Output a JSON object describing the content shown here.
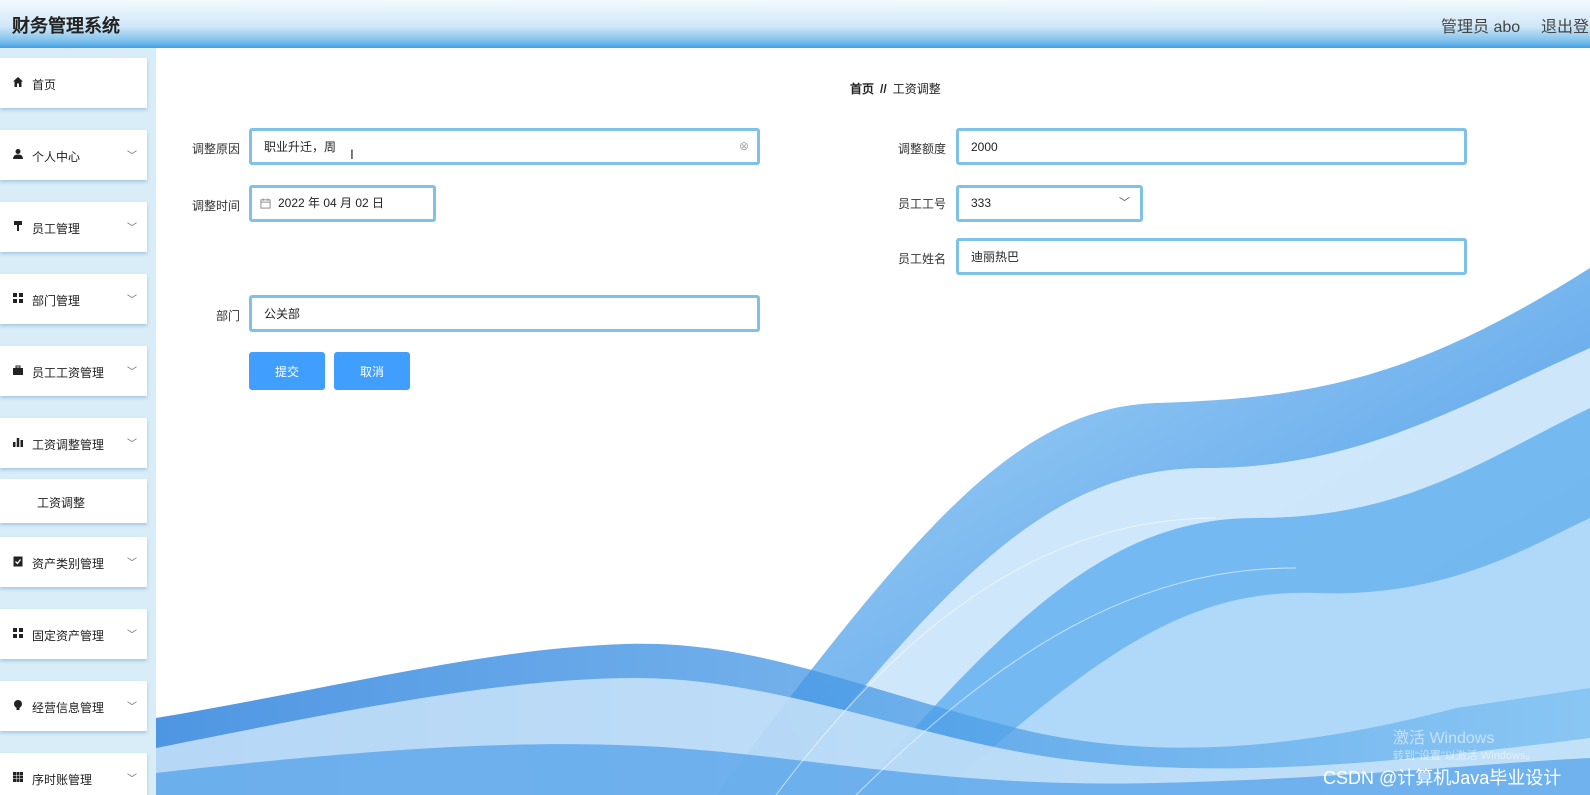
{
  "header": {
    "title": "财务管理系统",
    "admin": "管理员 abo",
    "logout": "退出登录"
  },
  "sidebar": {
    "items": [
      {
        "label": "首页",
        "icon": "home-icon",
        "glyph": "⌂",
        "has_children": false
      },
      {
        "label": "个人中心",
        "icon": "person-icon",
        "glyph": "●",
        "has_children": true
      },
      {
        "label": "员工管理",
        "icon": "paint-roller-icon",
        "glyph": "▀",
        "has_children": true
      },
      {
        "label": "部门管理",
        "icon": "grid-icon",
        "glyph": "▦",
        "has_children": true
      },
      {
        "label": "员工工资管理",
        "icon": "briefcase-icon",
        "glyph": "▬",
        "has_children": true
      },
      {
        "label": "工资调整管理",
        "icon": "bar-chart-icon",
        "glyph": "▮",
        "has_children": true
      },
      {
        "label": "资产类别管理",
        "icon": "clipboard-check-icon",
        "glyph": "☑",
        "has_children": true
      },
      {
        "label": "固定资产管理",
        "icon": "grid-icon",
        "glyph": "▦",
        "has_children": true
      },
      {
        "label": "经营信息管理",
        "icon": "lightbulb-icon",
        "glyph": "●",
        "has_children": true
      },
      {
        "label": "序时账管理",
        "icon": "calendar-grid-icon",
        "glyph": "▦",
        "has_children": true
      }
    ],
    "submenu": {
      "label": "工资调整"
    }
  },
  "breadcrumb": {
    "home": "首页",
    "separator": "//",
    "current": "工资调整"
  },
  "form": {
    "reason": {
      "label": "调整原因",
      "value": "职业升迁，周"
    },
    "amount": {
      "label": "调整额度",
      "value": "2000"
    },
    "time": {
      "label": "调整时间",
      "value": "2022 年 04 月 02 日"
    },
    "employee_no": {
      "label": "员工工号",
      "value": "333"
    },
    "employee_name": {
      "label": "员工姓名",
      "value": "迪丽热巴"
    },
    "department": {
      "label": "部门",
      "value": "公关部"
    },
    "submit": "提交",
    "cancel": "取消"
  },
  "watermark": {
    "activate_title": "激活 Windows",
    "activate_hint": "转到\"设置\"以激活 Windows。",
    "csdn": "CSDN @计算机Java毕业设计"
  },
  "colors": {
    "accent": "#409eff",
    "field_border": "#7fc1e8",
    "sidebar_bg": "#d9edf8"
  }
}
